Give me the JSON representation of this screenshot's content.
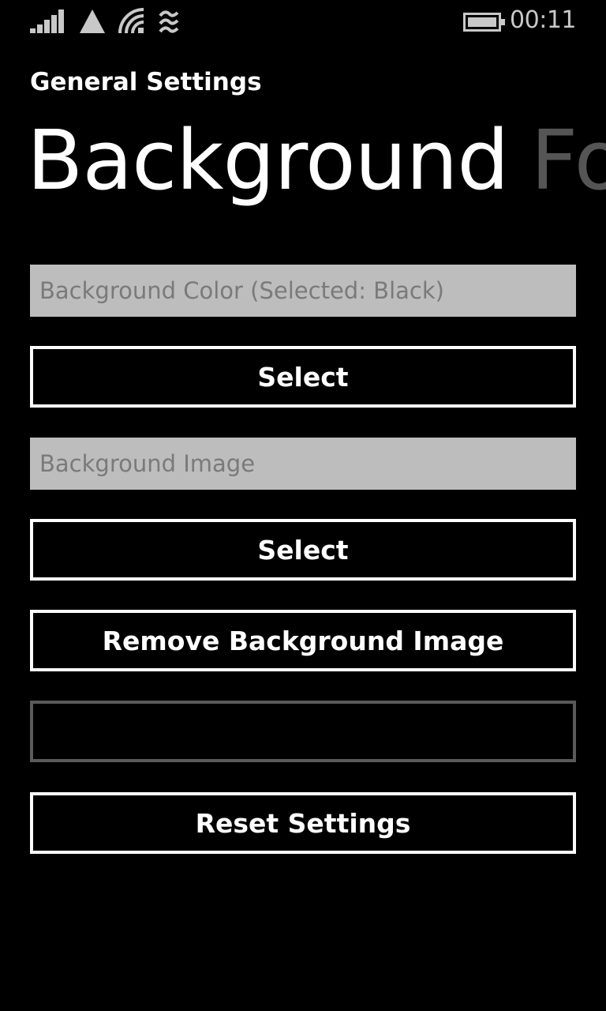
{
  "status_bar": {
    "time": "00:11",
    "icons": [
      "signal-strength-icon",
      "data-connection-icon",
      "wifi-icon",
      "nfc-icon",
      "battery-icon"
    ]
  },
  "header": {
    "app_title": "General Settings",
    "pivot_items": [
      "Background",
      "Fo"
    ]
  },
  "background_tab": {
    "color_field": "Background Color (Selected: Black)",
    "color_select_label": "Select",
    "image_field": "Background Image",
    "image_select_label": "Select",
    "remove_image_label": "Remove Background Image",
    "empty_button_label": "",
    "reset_label": "Reset Settings"
  },
  "colors": {
    "background": "#000000",
    "foreground": "#ffffff",
    "field_background": "#bdbdbd",
    "field_text": "#7a7a7a",
    "inactive_pivot": "#555555",
    "disabled_border": "#5a5a5a"
  }
}
